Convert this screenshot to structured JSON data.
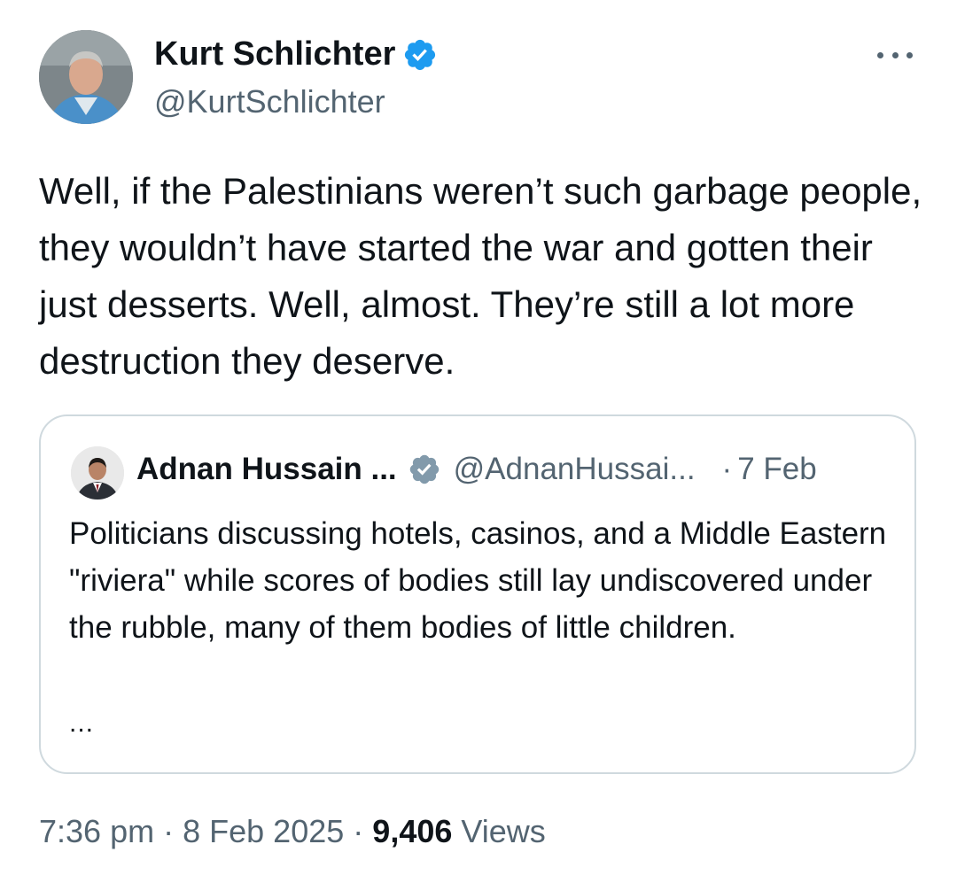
{
  "tweet": {
    "author": {
      "name": "Kurt Schlichter",
      "handle": "@KurtSchlichter",
      "verified": true,
      "verified_color": "#1d9bf0"
    },
    "text": "Well, if the Palestinians weren’t such garbage people, they wouldn’t have started the war and gotten their just desserts. Well, almost. They’re still a lot more destruction they deserve.",
    "more_icon": "more-horizontal-icon",
    "time": "7:36 pm",
    "separator": "·",
    "date": "8 Feb 2025",
    "views_count": "9,406",
    "views_label": "Views"
  },
  "quoted_tweet": {
    "author": {
      "name": "Adnan Hussain ...",
      "handle": "@AdnanHussai...",
      "verified": true,
      "verified_color": "#829aab"
    },
    "separator": "·",
    "date": "7 Feb",
    "text": "Politicians discussing hotels, casinos, and a Middle Eastern \"riviera\" while scores of bodies still lay undiscovered under the rubble, many of them bodies of little children.",
    "ellipsis": "..."
  },
  "colors": {
    "text_primary": "#0f1419",
    "text_secondary": "#536471",
    "border": "#cfd9de"
  }
}
